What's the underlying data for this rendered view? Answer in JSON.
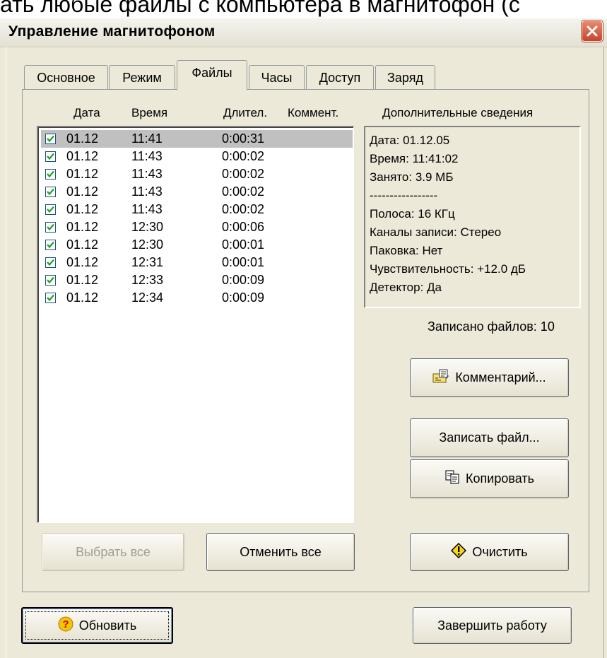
{
  "caption": "ать любые файлы с компьютера в магнитофон (с",
  "window": {
    "title": "Управление магнитофоном"
  },
  "tabs": [
    {
      "label": "Основное",
      "active": false
    },
    {
      "label": "Режим",
      "active": false
    },
    {
      "label": "Файлы",
      "active": true
    },
    {
      "label": "Часы",
      "active": false
    },
    {
      "label": "Доступ",
      "active": false
    },
    {
      "label": "Заряд",
      "active": false
    }
  ],
  "file_list": {
    "headers": [
      "Дата",
      "Время",
      "Длител.",
      "Коммент."
    ],
    "rows": [
      {
        "date": "01.12",
        "time": "11:41",
        "duration": "0:00:31",
        "checked": true,
        "selected": true
      },
      {
        "date": "01.12",
        "time": "11:43",
        "duration": "0:00:02",
        "checked": true
      },
      {
        "date": "01.12",
        "time": "11:43",
        "duration": "0:00:02",
        "checked": true
      },
      {
        "date": "01.12",
        "time": "11:43",
        "duration": "0:00:02",
        "checked": true
      },
      {
        "date": "01.12",
        "time": "11:43",
        "duration": "0:00:02",
        "checked": true
      },
      {
        "date": "01.12",
        "time": "12:30",
        "duration": "0:00:06",
        "checked": true
      },
      {
        "date": "01.12",
        "time": "12:30",
        "duration": "0:00:01",
        "checked": true
      },
      {
        "date": "01.12",
        "time": "12:31",
        "duration": "0:00:01",
        "checked": true
      },
      {
        "date": "01.12",
        "time": "12:33",
        "duration": "0:00:09",
        "checked": true
      },
      {
        "date": "01.12",
        "time": "12:34",
        "duration": "0:00:09",
        "checked": true
      }
    ]
  },
  "info": {
    "title": "Дополнительные сведения",
    "lines": [
      "Дата: 01.12.05",
      "Время: 11:41:02",
      "Занято: 3.9 МБ",
      "-----------------",
      "Полоса: 16 КГц",
      "Каналы записи: Стерео",
      "Паковка: Нет",
      "Чувствительность: +12.0 дБ",
      "Детектор: Да"
    ],
    "files_written": "Записано файлов: 10"
  },
  "buttons": {
    "comment": "Комментарий...",
    "write_file": "Записать файл...",
    "copy": "Копировать",
    "select_all": "Выбрать все",
    "deselect_all": "Отменить все",
    "clear": "Очистить",
    "refresh": "Обновить",
    "exit": "Завершить работу"
  },
  "icons": {
    "close": "close-icon",
    "comment": "comment-icon",
    "copy": "copy-icon",
    "warning": "warning-icon",
    "help": "help-icon",
    "checkbox": "checkmark-icon"
  },
  "colors": {
    "window_bg": "#ece9d8",
    "selection": "#c0c0c0",
    "close_red": "#c6452a"
  }
}
